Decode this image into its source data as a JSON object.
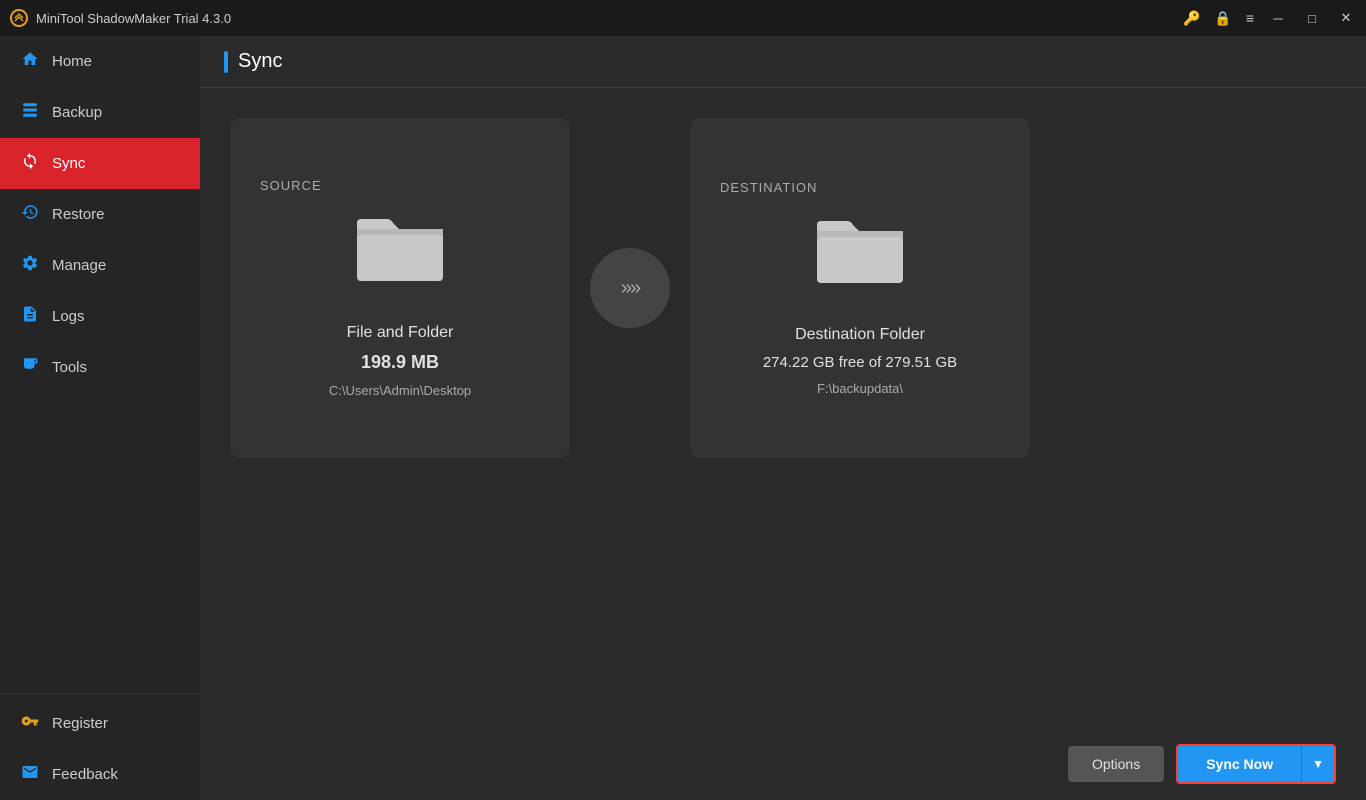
{
  "titlebar": {
    "title": "MiniTool ShadowMaker Trial 4.3.0"
  },
  "sidebar": {
    "items": [
      {
        "id": "home",
        "label": "Home",
        "icon": "home"
      },
      {
        "id": "backup",
        "label": "Backup",
        "icon": "backup"
      },
      {
        "id": "sync",
        "label": "Sync",
        "icon": "sync",
        "active": true
      },
      {
        "id": "restore",
        "label": "Restore",
        "icon": "restore"
      },
      {
        "id": "manage",
        "label": "Manage",
        "icon": "manage"
      },
      {
        "id": "logs",
        "label": "Logs",
        "icon": "logs"
      },
      {
        "id": "tools",
        "label": "Tools",
        "icon": "tools"
      }
    ],
    "bottom_items": [
      {
        "id": "register",
        "label": "Register",
        "icon": "register"
      },
      {
        "id": "feedback",
        "label": "Feedback",
        "icon": "feedback"
      }
    ]
  },
  "page": {
    "title": "Sync"
  },
  "source": {
    "label": "SOURCE",
    "name": "File and Folder",
    "size": "198.9 MB",
    "path": "C:\\Users\\Admin\\Desktop"
  },
  "destination": {
    "label": "DESTINATION",
    "name": "Destination Folder",
    "free": "274.22 GB free of 279.51 GB",
    "path": "F:\\backupdata\\"
  },
  "buttons": {
    "options": "Options",
    "sync_now": "Sync Now"
  },
  "colors": {
    "active_nav": "#d9232a",
    "accent_blue": "#2196f3",
    "sync_border": "#f44336"
  }
}
